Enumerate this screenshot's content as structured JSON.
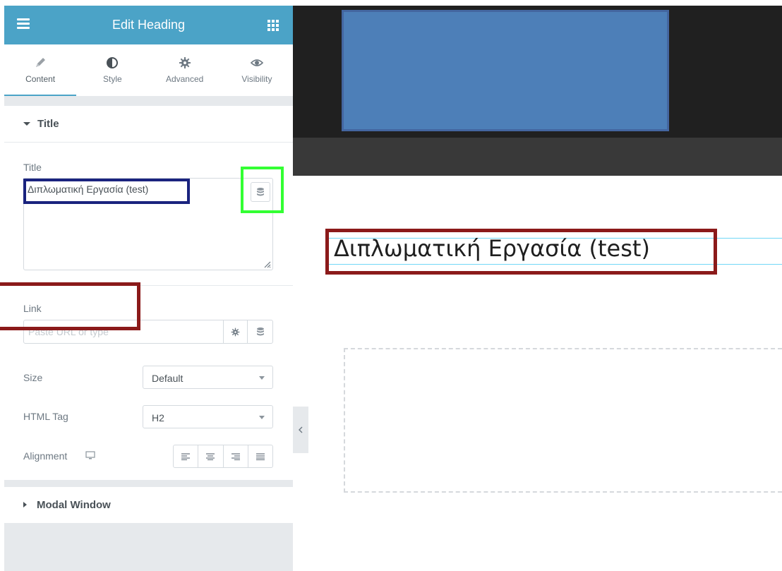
{
  "panel": {
    "header": {
      "title": "Edit Heading",
      "menu_icon": "hamburger-icon",
      "grid_icon": "apps-grid-icon",
      "color": "#4ba3c7"
    },
    "tabs": [
      {
        "label": "Content",
        "icon": "pencil-icon",
        "active": true
      },
      {
        "label": "Style",
        "icon": "half-circle-icon",
        "active": false
      },
      {
        "label": "Advanced",
        "icon": "gear-icon",
        "active": false
      },
      {
        "label": "Visibility",
        "icon": "eye-icon",
        "active": false
      }
    ],
    "section_title": {
      "label": "Title"
    },
    "title_field": {
      "label": "Title",
      "value": "Διπλωματική Εργασία (test)",
      "dynamic_icon": "database-icon"
    },
    "link_field": {
      "label": "Link",
      "placeholder": "Paste URL or type",
      "settings_icon": "gear-icon",
      "dynamic_icon": "database-icon"
    },
    "size_field": {
      "label": "Size",
      "value": "Default"
    },
    "html_tag_field": {
      "label": "HTML Tag",
      "value": "H2"
    },
    "alignment_field": {
      "label": "Alignment",
      "device_icon": "desktop-icon",
      "options": [
        "align-left-icon",
        "align-center-icon",
        "align-right-icon",
        "align-justify-icon"
      ]
    },
    "modal_section": {
      "label": "Modal Window"
    }
  },
  "preview": {
    "heading_text": "Διπλωματική Εργασία (test)",
    "collapse_icon": "chevron-left-icon",
    "block_color": "#4d7fb8"
  },
  "annotations": {
    "title_value_box_color": "#1a237e",
    "dynamic_button_box_color": "#33ff33",
    "link_label_box_color": "#8b1a1a",
    "preview_heading_box_color": "#8b1a1a"
  }
}
